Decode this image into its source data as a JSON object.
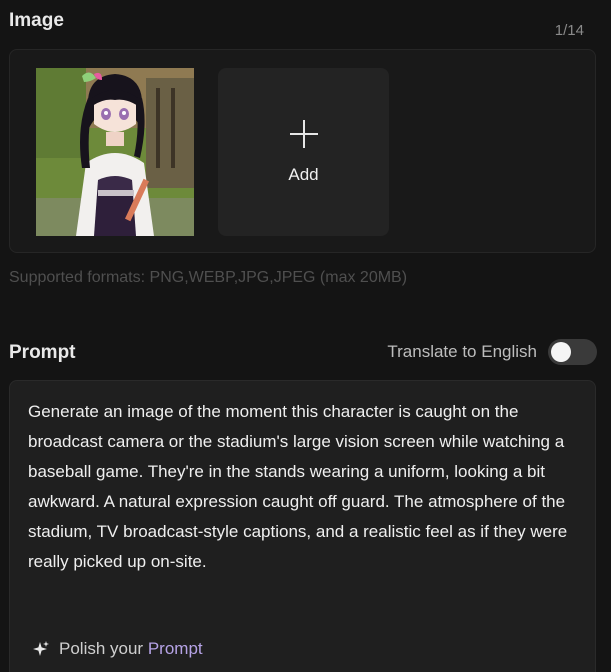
{
  "image_section": {
    "title": "Image",
    "counter": "1/14",
    "add_label": "Add",
    "formats_note": "Supported formats: PNG,WEBP,JPG,JPEG (max 20MB)"
  },
  "prompt_section": {
    "title": "Prompt",
    "translate_label": "Translate to English",
    "translate_enabled": false,
    "prompt_text": "Generate an image of the moment this character is caught on the broadcast camera or the stadium's large vision screen while watching a baseball game. They're in the stands wearing a uniform, looking a bit awkward. A natural expression caught off guard. The atmosphere of the stadium, TV broadcast-style captions, and a realistic feel as if they were really picked up on-site.",
    "polish_prefix": "Polish your ",
    "polish_accent": "Prompt"
  },
  "icons": {
    "add": "plus-icon",
    "polish": "sparkle-icon"
  },
  "colors": {
    "background": "#141414",
    "panel": "#191919",
    "accent_purple": "#b6a3e6"
  }
}
